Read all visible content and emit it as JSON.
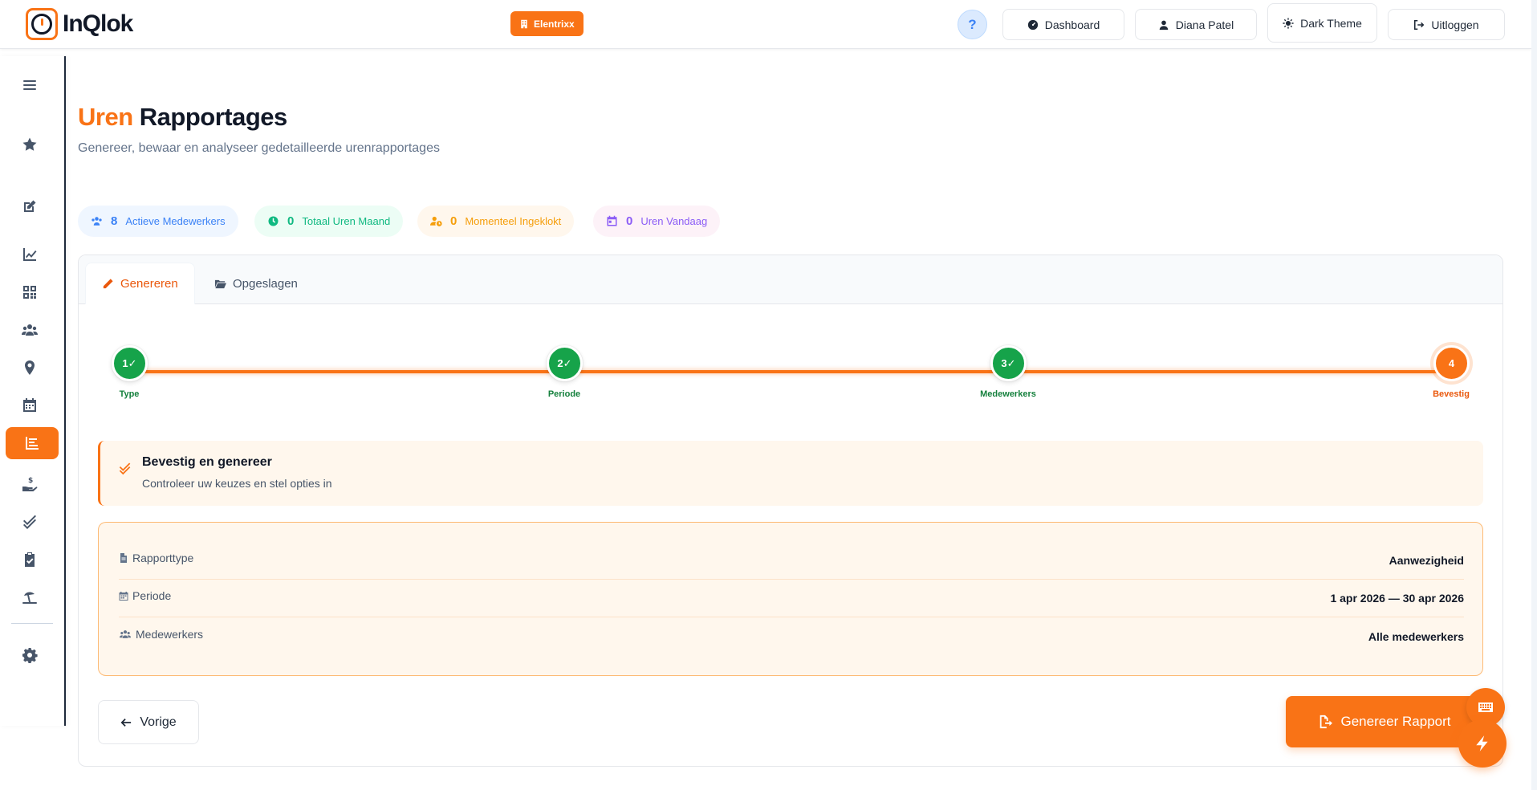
{
  "header": {
    "logo_text": "InQlok",
    "company": "Elentrixx",
    "help": "?",
    "buttons": {
      "dashboard": "Dashboard",
      "user": "Diana Patel",
      "theme": "Dark Theme",
      "logout": "Uitloggen"
    }
  },
  "page": {
    "title_accent": "Uren",
    "title_main": "Rapportages",
    "subtitle": "Genereer, bewaar en analyseer gedetailleerde urenrapportages"
  },
  "stats": [
    {
      "value": "8",
      "label": "Actieve Medewerkers",
      "color": "#3b82f6",
      "bg": "#eff6ff"
    },
    {
      "value": "0",
      "label": "Totaal Uren Maand",
      "color": "#10b981",
      "bg": "#ecfdf5"
    },
    {
      "value": "0",
      "label": "Momenteel Ingeklokt",
      "color": "#f59e0b",
      "bg": "#fff7ed"
    },
    {
      "value": "0",
      "label": "Uren Vandaag",
      "color": "#8b5cf6",
      "bg": "#fdf2f8"
    }
  ],
  "tabs": {
    "generate": "Genereren",
    "saved": "Opgeslagen"
  },
  "steps": [
    {
      "number": "1",
      "label": "Type",
      "state": "done"
    },
    {
      "number": "2",
      "label": "Periode",
      "state": "done"
    },
    {
      "number": "3",
      "label": "Medewerkers",
      "state": "done"
    },
    {
      "number": "4",
      "label": "Bevestig",
      "state": "current"
    }
  ],
  "info": {
    "title": "Bevestig en genereer",
    "subtitle": "Controleer uw keuzes en stel opties in"
  },
  "summary": [
    {
      "label": "Rapporttype",
      "value": "Aanwezigheid",
      "icon": "file-icon"
    },
    {
      "label": "Periode",
      "value": "1 apr 2026 — 30 apr 2026",
      "icon": "calendar-icon"
    },
    {
      "label": "Medewerkers",
      "value": "Alle medewerkers",
      "icon": "users-icon"
    }
  ],
  "actions": {
    "previous": "Vorige",
    "generate": "Genereer Rapport"
  },
  "colors": {
    "accent": "#f97316",
    "success": "#16a34a"
  }
}
